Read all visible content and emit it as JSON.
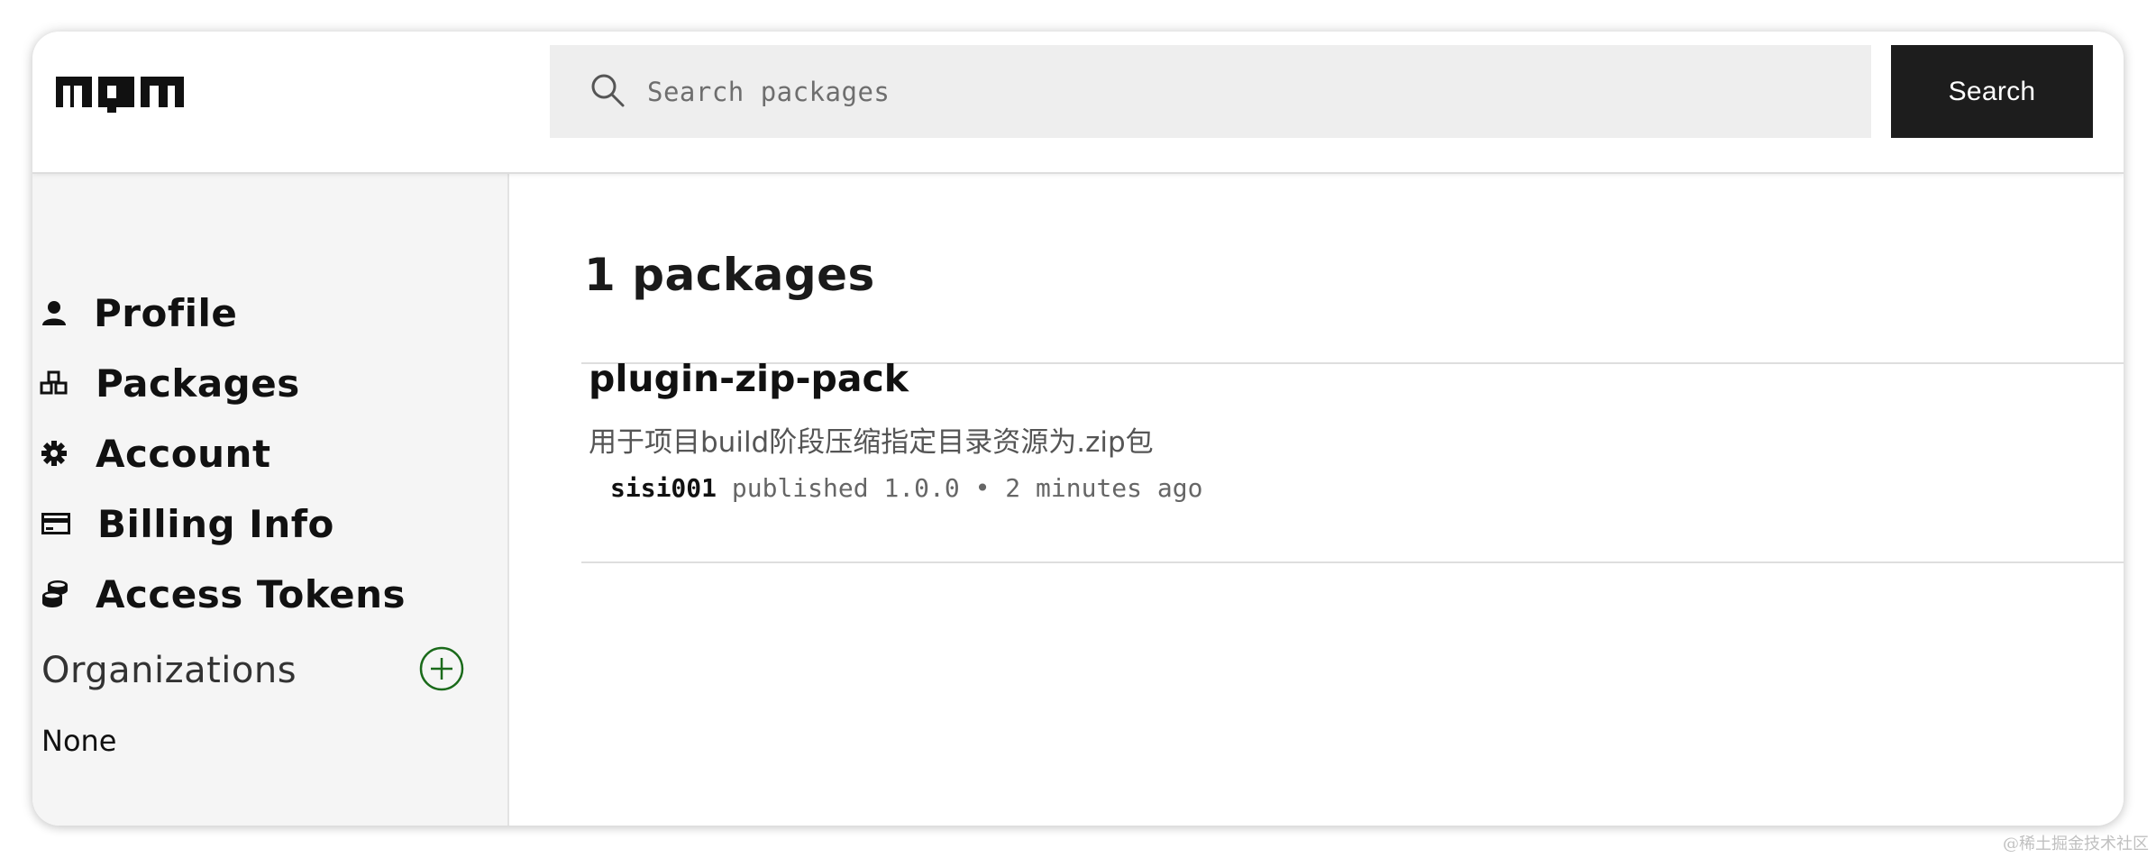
{
  "search": {
    "placeholder": "Search packages",
    "button_label": "Search"
  },
  "sidebar": {
    "items": [
      {
        "label": "Profile",
        "icon": "user-icon"
      },
      {
        "label": "Packages",
        "icon": "cubes-icon"
      },
      {
        "label": "Account",
        "icon": "gear-icon"
      },
      {
        "label": "Billing Info",
        "icon": "credit-card-icon"
      },
      {
        "label": "Access Tokens",
        "icon": "coins-icon"
      }
    ],
    "organizations": {
      "title": "Organizations",
      "empty_text": "None"
    }
  },
  "main": {
    "package_count_label": "1 packages",
    "packages": [
      {
        "name": "plugin-zip-pack",
        "description": "用于项目build阶段压缩指定目录资源为.zip包",
        "author": "sisi001",
        "published_text": " published 1.0.0 • 2 minutes ago"
      }
    ]
  },
  "watermark": "@稀土掘金技术社区",
  "colors": {
    "search_button_bg": "#1d1d1d",
    "sidebar_bg": "#f5f5f5",
    "search_bg": "#eeeeee",
    "add_org_accent": "#1a6a1a"
  }
}
